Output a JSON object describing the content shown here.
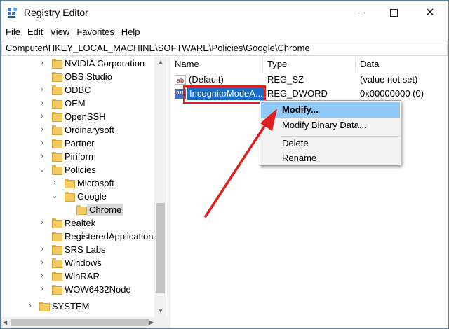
{
  "window": {
    "title": "Registry Editor",
    "controls": {
      "minimize": "—",
      "maximize": "☐",
      "close": "✕"
    }
  },
  "menu": [
    "File",
    "Edit",
    "View",
    "Favorites",
    "Help"
  ],
  "address": "Computer\\HKEY_LOCAL_MACHINE\\SOFTWARE\\Policies\\Google\\Chrome",
  "tree": [
    {
      "label": "NVIDIA Corporation",
      "expander": "›"
    },
    {
      "label": "OBS Studio",
      "expander": ""
    },
    {
      "label": "ODBC",
      "expander": "›"
    },
    {
      "label": "OEM",
      "expander": "›"
    },
    {
      "label": "OpenSSH",
      "expander": "›"
    },
    {
      "label": "Ordinarysoft",
      "expander": "›"
    },
    {
      "label": "Partner",
      "expander": "›"
    },
    {
      "label": "Piriform",
      "expander": "›"
    },
    {
      "label": "Policies",
      "expander": "⌄"
    },
    {
      "label": "Microsoft",
      "expander": "›"
    },
    {
      "label": "Google",
      "expander": "⌄"
    },
    {
      "label": "Chrome",
      "expander": ""
    },
    {
      "label": "Realtek",
      "expander": "›"
    },
    {
      "label": "RegisteredApplications",
      "expander": ""
    },
    {
      "label": "SRS Labs",
      "expander": "›"
    },
    {
      "label": "Windows",
      "expander": "›"
    },
    {
      "label": "WinRAR",
      "expander": "›"
    },
    {
      "label": "WOW6432Node",
      "expander": "›"
    },
    {
      "label": "SYSTEM",
      "expander": "›"
    }
  ],
  "columns": {
    "name": "Name",
    "type": "Type",
    "data": "Data"
  },
  "values": [
    {
      "icon": "ab",
      "name": "(Default)",
      "type": "REG_SZ",
      "data": "(value not set)"
    },
    {
      "icon": "011",
      "name": "IncognitoModeA...",
      "type": "REG_DWORD",
      "data": "0x00000000 (0)"
    }
  ],
  "context_menu": [
    "Modify...",
    "Modify Binary Data...",
    "Delete",
    "Rename"
  ],
  "scroll_arrows": {
    "up": "▲",
    "down": "▼",
    "left": "◀",
    "right": "▶"
  },
  "colors": {
    "selection": "#1a6cc9",
    "menu_hover": "#91c9f7",
    "annotation": "#e01c1c"
  }
}
